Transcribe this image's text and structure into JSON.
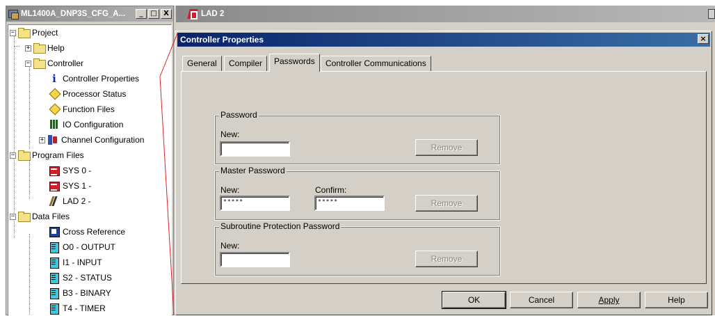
{
  "project_window": {
    "title": "ML1400A_DNP3S_CFG_A...",
    "buttons": [
      "_",
      "□",
      "X"
    ],
    "tree": [
      {
        "label": "Project",
        "icon": "folder-icon",
        "expander": "−"
      },
      {
        "label": "Help",
        "icon": "folder-icon",
        "expander": "+"
      },
      {
        "label": "Controller",
        "icon": "folder-icon",
        "expander": "−"
      },
      {
        "label": "Controller Properties",
        "icon": "info-icon"
      },
      {
        "label": "Processor Status",
        "icon": "diamond-icon"
      },
      {
        "label": "Function Files",
        "icon": "diamond-icon"
      },
      {
        "label": "IO Configuration",
        "icon": "io-icon"
      },
      {
        "label": "Channel Configuration",
        "icon": "channel-icon",
        "expander": "+"
      },
      {
        "label": "Program Files",
        "icon": "folder-icon",
        "expander": "−"
      },
      {
        "label": "SYS 0 -",
        "icon": "sys-program-icon"
      },
      {
        "label": "SYS 1 -",
        "icon": "sys-program-icon"
      },
      {
        "label": "LAD 2 -",
        "icon": "ladder-icon"
      },
      {
        "label": "Data Files",
        "icon": "folder-icon",
        "expander": "−"
      },
      {
        "label": "Cross Reference",
        "icon": "cross-reference-icon"
      },
      {
        "label": "O0 - OUTPUT",
        "icon": "data-file-icon"
      },
      {
        "label": "I1 - INPUT",
        "icon": "data-file-icon"
      },
      {
        "label": "S2 - STATUS",
        "icon": "data-file-icon"
      },
      {
        "label": "B3 - BINARY",
        "icon": "data-file-icon"
      },
      {
        "label": "T4 - TIMER",
        "icon": "data-file-icon"
      }
    ]
  },
  "lad_window": {
    "title": "LAD 2"
  },
  "dialog": {
    "title": "Controller Properties",
    "close": "×",
    "tabs": [
      "General",
      "Compiler",
      "Passwords",
      "Controller Communications"
    ],
    "active_tab": "Passwords",
    "password_group": {
      "label": "Password",
      "new_label": "New:",
      "new_value": "",
      "remove": "Remove"
    },
    "master_group": {
      "label": "Master Password",
      "new_label": "New:",
      "new_value": "*****",
      "confirm_label": "Confirm:",
      "confirm_value": "*****",
      "remove": "Remove"
    },
    "subroutine_group": {
      "label": "Subroutine Protection Password",
      "new_label": "New:",
      "new_value": "",
      "remove": "Remove"
    },
    "buttons": {
      "ok": "OK",
      "cancel": "Cancel",
      "apply": "Apply",
      "help": "Help"
    }
  }
}
